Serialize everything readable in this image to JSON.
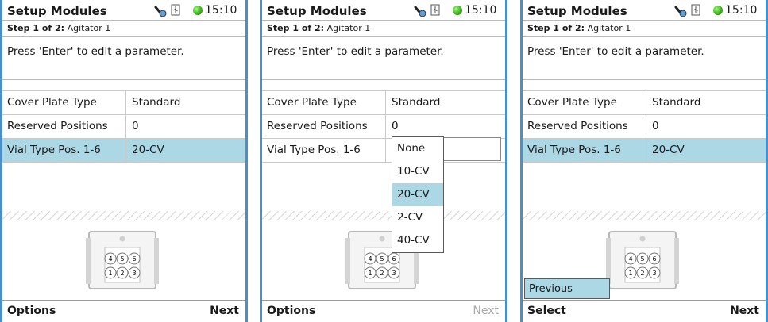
{
  "screens": [
    {
      "title": "Setup Modules",
      "time": "15:10",
      "step_label": "Step 1 of 2:",
      "step_name": "Agitator 1",
      "hint": "Press 'Enter' to edit a parameter.",
      "params": [
        {
          "name": "Cover Plate Type",
          "value": "Standard"
        },
        {
          "name": "Reserved Positions",
          "value": "0"
        },
        {
          "name": "Vial Type Pos. 1-6",
          "value": "20-CV"
        }
      ],
      "selected_param": "Vial Type Pos. 1-6",
      "softkey_left": "Options",
      "softkey_right": "Next"
    },
    {
      "title": "Setup Modules",
      "time": "15:10",
      "step_label": "Step 1 of 2:",
      "step_name": "Agitator 1",
      "hint": "Press 'Enter' to edit a parameter.",
      "params": [
        {
          "name": "Cover Plate Type",
          "value": "Standard"
        },
        {
          "name": "Reserved Positions",
          "value": "0"
        },
        {
          "name": "Vial Type Pos. 1-6",
          "value": ""
        }
      ],
      "dropdown": {
        "options": [
          "None",
          "10-CV",
          "20-CV",
          "2-CV",
          "40-CV"
        ],
        "selected": "20-CV"
      },
      "softkey_left": "Options",
      "softkey_right": "Next",
      "softkey_right_disabled": true
    },
    {
      "title": "Setup Modules",
      "time": "15:10",
      "step_label": "Step 1 of 2:",
      "step_name": "Agitator 1",
      "hint": "Press 'Enter' to edit a parameter.",
      "params": [
        {
          "name": "Cover Plate Type",
          "value": "Standard"
        },
        {
          "name": "Reserved Positions",
          "value": "0"
        },
        {
          "name": "Vial Type Pos. 1-6",
          "value": "20-CV"
        }
      ],
      "selected_param": "Vial Type Pos. 1-6",
      "menu_item": "Previous",
      "softkey_left": "Select",
      "softkey_right": "Next"
    }
  ],
  "module_positions": {
    "top_row": [
      "4",
      "5",
      "6"
    ],
    "bottom_row": [
      "1",
      "2",
      "3"
    ]
  },
  "colors": {
    "frame": "#4a8fc8",
    "selection": "#acd8e6",
    "status_ok": "#39b316",
    "disabled_text": "#a9a9a9"
  },
  "icons": [
    "wrench-icon",
    "usb-icon",
    "status-ok-icon"
  ]
}
